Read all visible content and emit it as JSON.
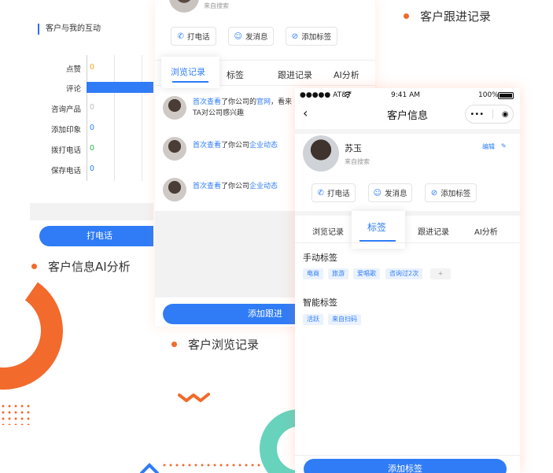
{
  "captions": {
    "left": "客户信息AI分析",
    "middle": "客户浏览记录",
    "right": "客户跟进记录"
  },
  "left_panel": {
    "title": "客户与我的互动",
    "rows": [
      {
        "label": "点赞",
        "value": "0",
        "color": "#f5a623"
      },
      {
        "label": "评论",
        "value": "",
        "color": "#2f7cf6"
      },
      {
        "label": "咨询产品",
        "value": "0",
        "color": "#bbbbbb"
      },
      {
        "label": "添加印象",
        "value": "0",
        "color": "#2f7cf6"
      },
      {
        "label": "拨打电话",
        "value": "0",
        "color": "#2db84d"
      },
      {
        "label": "保存电话",
        "value": "0",
        "color": "#2f7cf6"
      }
    ],
    "button": "打电话"
  },
  "middle_panel": {
    "source": "来自搜索",
    "actions": {
      "call": "打电话",
      "message": "发消息",
      "tag": "添加标签"
    },
    "tabs": [
      "浏览记录",
      "标签",
      "跟进记录",
      "AI分析"
    ],
    "active_tab": "浏览记录",
    "records": [
      {
        "p1": "首次查看",
        "p2": "了你公司的",
        "p3": "官网",
        "p4": "，看来",
        "line2": "TA对公司感兴趣"
      },
      {
        "p1": "首次查看",
        "p2": "了你公司",
        "p3": "企业动态",
        "p4": "",
        "line2": ""
      },
      {
        "p1": "首次查看",
        "p2": "了你公司",
        "p3": "企业动态",
        "p4": "",
        "line2": ""
      }
    ],
    "button": "添加跟进"
  },
  "phone": {
    "status": {
      "carrier": "●●●●● AT&T",
      "wifi": "wifi-icon",
      "time": "9:41 AM",
      "battery": "100%"
    },
    "title": "客户信息",
    "capsule": {
      "more": "•••",
      "close": "◉"
    },
    "customer": {
      "name": "苏玉",
      "source": "来自搜索",
      "edit": "编辑"
    },
    "actions": {
      "call": "打电话",
      "message": "发消息",
      "tag": "添加标签"
    },
    "tabs": [
      "浏览记录",
      "标签",
      "跟进记录",
      "AI分析"
    ],
    "active_tab": "标签",
    "manual_title": "手动标签",
    "manual_tags": [
      "电商",
      "旅游",
      "爱唱歌",
      "咨询过2次",
      "+"
    ],
    "smart_title": "智能标签",
    "smart_tags": [
      "活跃",
      "来自扫码"
    ],
    "button": "添加标签"
  },
  "colors": {
    "accent": "#2f7cf6",
    "brand_orange": "#f26a2c",
    "teal": "#67d3bd"
  }
}
